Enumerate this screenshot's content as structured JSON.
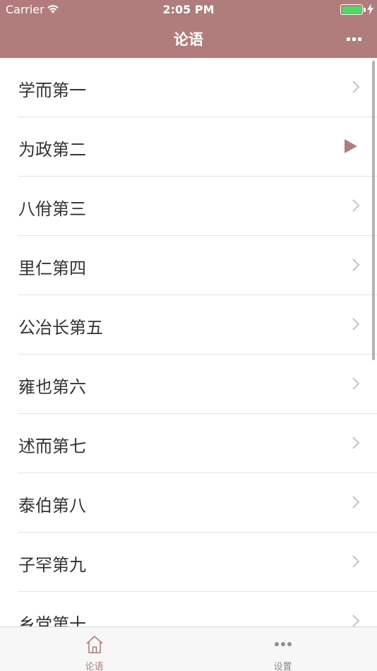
{
  "status_bar": {
    "carrier": "Carrier",
    "time": "2:05 PM",
    "battery_color": "#4cd964"
  },
  "nav": {
    "title": "论语",
    "more_icon": "more-icon"
  },
  "colors": {
    "accent": "#b07c7c",
    "separator": "#e2e2e2",
    "text": "#333333"
  },
  "chapters": [
    {
      "label": "学而第一",
      "indicator": "chevron"
    },
    {
      "label": "为政第二",
      "indicator": "play"
    },
    {
      "label": "八佾第三",
      "indicator": "chevron"
    },
    {
      "label": "里仁第四",
      "indicator": "chevron"
    },
    {
      "label": "公冶长第五",
      "indicator": "chevron"
    },
    {
      "label": "雍也第六",
      "indicator": "chevron"
    },
    {
      "label": "述而第七",
      "indicator": "chevron"
    },
    {
      "label": "泰伯第八",
      "indicator": "chevron"
    },
    {
      "label": "子罕第九",
      "indicator": "chevron"
    },
    {
      "label": "乡党第十",
      "indicator": "chevron"
    }
  ],
  "tabs": [
    {
      "label": "论语",
      "icon": "home-icon",
      "active": true
    },
    {
      "label": "设置",
      "icon": "more-dots-icon",
      "active": false
    }
  ]
}
